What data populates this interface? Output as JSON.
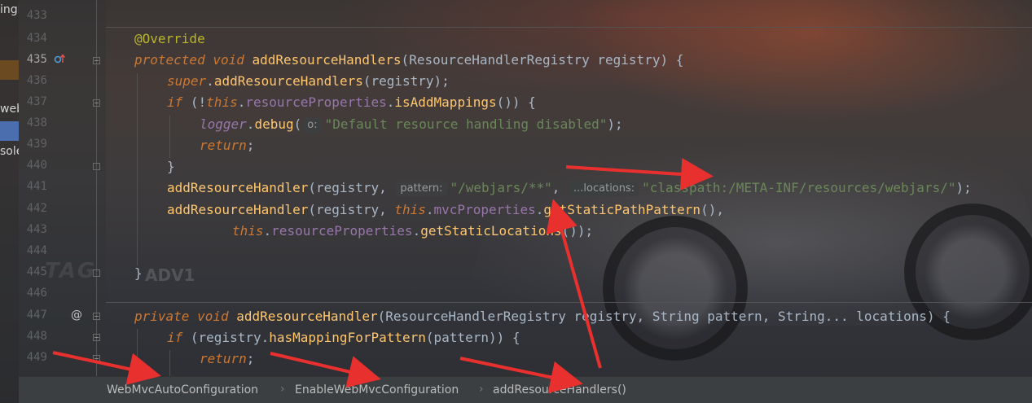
{
  "left_panel": {
    "fragments": [
      "ingl",
      "web",
      "sole"
    ]
  },
  "gutter": {
    "line_numbers": [
      "433",
      "434",
      "435",
      "436",
      "437",
      "438",
      "439",
      "440",
      "441",
      "442",
      "443",
      "444",
      "445",
      "446",
      "447",
      "448",
      "449"
    ],
    "override_icon": "override-method-icon",
    "at_symbol": "@"
  },
  "code": {
    "annotation": "@Override",
    "kw_protected": "protected",
    "kw_void": "void",
    "kw_private": "private",
    "kw_super": "super",
    "kw_if": "if",
    "kw_this": "this",
    "kw_return": "return",
    "method_add_resource_handlers": "addResourceHandlers",
    "method_add_resource_handler": "addResourceHandler",
    "class_registry": "ResourceHandlerRegistry",
    "class_string": "String",
    "param_registry": "registry",
    "param_pattern": "pattern",
    "param_locations": "locations",
    "field_resource_properties": "resourceProperties",
    "field_mvc_properties": "mvcProperties",
    "field_logger": "logger",
    "call_is_add_mappings": "isAddMappings",
    "call_debug": "debug",
    "call_get_static_path_pattern": "getStaticPathPattern",
    "call_get_static_locations": "getStaticLocations",
    "call_has_mapping_for_pattern": "hasMappingForPattern",
    "str_disabled": "\"Default resource handling disabled\"",
    "str_webjars": "\"/webjars/**\"",
    "str_classpath": "\"classpath:/META-INF/resources/webjars/\"",
    "hint_o": "o:",
    "hint_pattern": "pattern:",
    "hint_locations": "...locations:"
  },
  "watermark": {
    "logo_text": "TAG",
    "logo_text_2": "ADV1"
  },
  "breadcrumb": {
    "items": [
      "WebMvcAutoConfiguration",
      "EnableWebMvcConfiguration",
      "addResourceHandlers()"
    ],
    "separator": "›"
  },
  "annotations": {
    "arrow_color": "#e8302e"
  },
  "colors": {
    "keyword": "#cc7832",
    "annotation": "#bbb529",
    "method": "#ffc66d",
    "field": "#9876aa",
    "string": "#6a8759",
    "text": "#a9b7c6"
  }
}
